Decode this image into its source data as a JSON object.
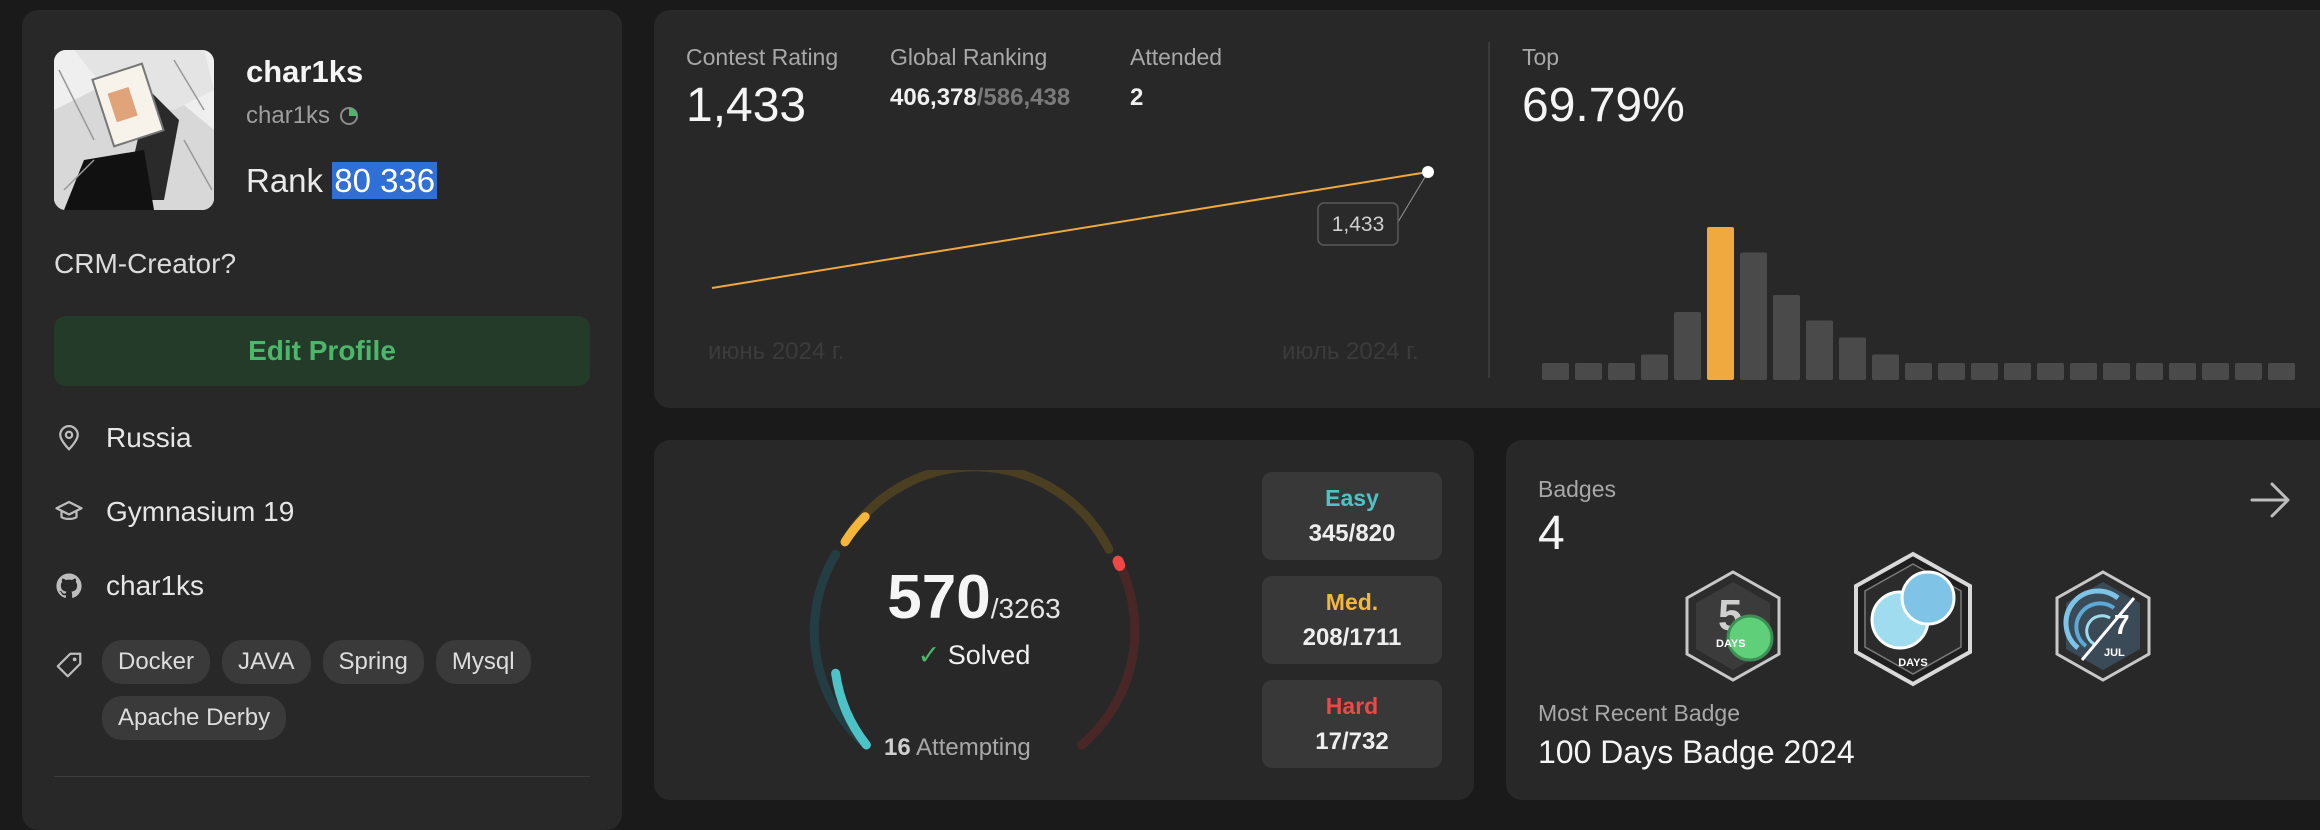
{
  "profile": {
    "username": "char1ks",
    "handle": "char1ks",
    "rank_label": "Rank",
    "rank_value": "80 336",
    "bio": "CRM-Creator?",
    "edit_label": "Edit Profile",
    "location": "Russia",
    "school": "Gymnasium 19",
    "github": "char1ks",
    "tags": [
      "Docker",
      "JAVA",
      "Spring",
      "Mysql",
      "Apache Derby"
    ]
  },
  "contest": {
    "rating_label": "Contest Rating",
    "rating_value": "1,433",
    "global_label": "Global Ranking",
    "global_rank": "406,378",
    "global_total": "/586,438",
    "attended_label": "Attended",
    "attended_value": "2",
    "tooltip_value": "1,433",
    "date_start": "июнь 2024 г.",
    "date_end": "июль 2024 г.",
    "top_label": "Top",
    "top_value": "69.79%",
    "accent_color": "#f0a93e"
  },
  "solved": {
    "solved_count": "570",
    "total": "/3263",
    "solved_label": "Solved",
    "attempting_count": "16",
    "attempting_label": "Attempting",
    "easy": {
      "label": "Easy",
      "value": "345/820",
      "color": "#4ec3c7"
    },
    "medium": {
      "label": "Med.",
      "value": "208/1711",
      "color": "#f5b73b"
    },
    "hard": {
      "label": "Hard",
      "value": "17/732",
      "color": "#ef4743"
    }
  },
  "badges": {
    "label": "Badges",
    "count": "4",
    "recent_label": "Most Recent Badge",
    "recent_name": "100 Days Badge 2024",
    "badge1_text": "DAYS",
    "badge2_text": "DAYS",
    "badge3_num": "7",
    "badge3_month": "JUL"
  },
  "chart_data": {
    "type": "bar",
    "values": [
      2,
      2,
      2,
      3,
      8,
      18,
      15,
      10,
      7,
      5,
      3,
      2,
      2,
      2,
      2,
      2,
      2,
      2,
      2,
      2,
      2,
      2,
      2
    ],
    "highlight_index": 5,
    "ylim": [
      0,
      20
    ]
  }
}
